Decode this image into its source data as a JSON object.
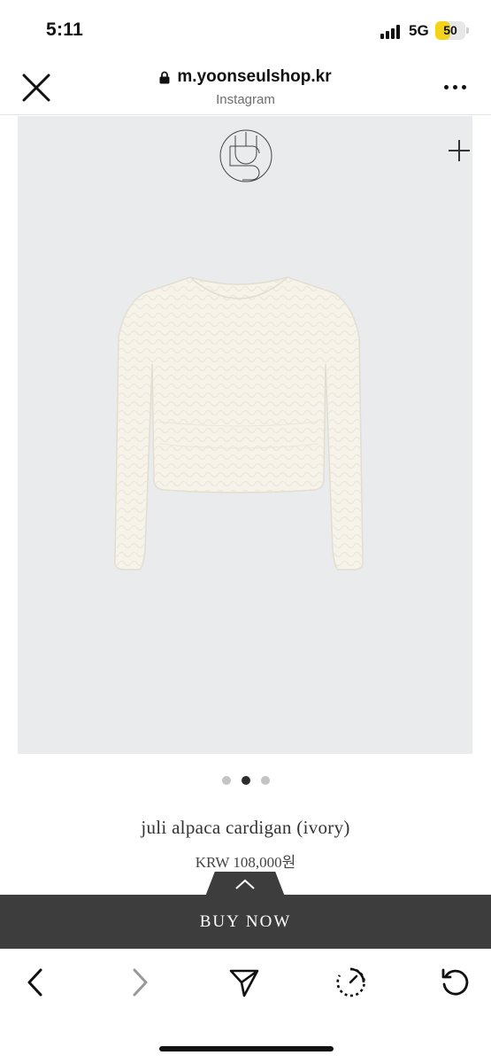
{
  "status": {
    "time": "5:11",
    "network": "5G",
    "battery": "50",
    "battery_level": 0.5
  },
  "browser": {
    "url": "m.yoonseulshop.kr",
    "source": "Instagram",
    "icons": [
      "close-icon",
      "lock-icon",
      "more-icon"
    ]
  },
  "product": {
    "name": "juli alpaca cardigan (ivory)",
    "price": "KRW 108,000원",
    "image_count": 3,
    "active_image": 2
  },
  "actions": {
    "buy_label": "BUY NOW"
  },
  "toolbar": {
    "items": [
      "back-icon",
      "forward-icon",
      "share-icon",
      "speed-icon",
      "reload-icon"
    ]
  },
  "colors": {
    "buy_bar": "#3d3d3d",
    "image_bg": "#eaebed",
    "battery": "#f4d41a"
  }
}
